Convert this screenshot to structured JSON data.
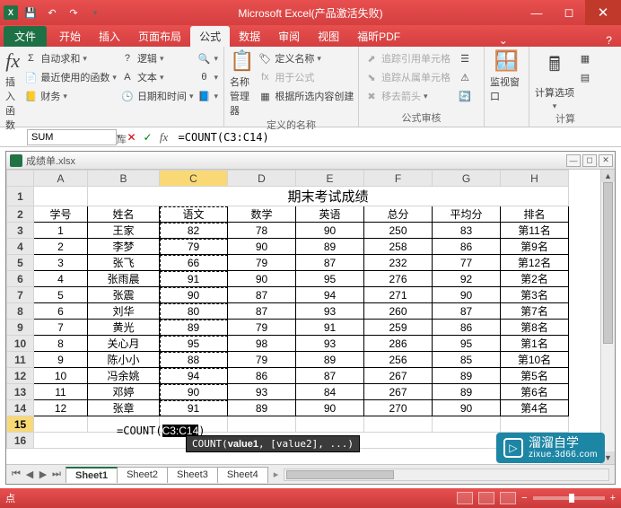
{
  "titlebar": {
    "app_title": "Microsoft Excel(产品激活失败)"
  },
  "tabs": {
    "file": "文件",
    "items": [
      "开始",
      "插入",
      "页面布局",
      "公式",
      "数据",
      "审阅",
      "视图",
      "福昕PDF"
    ],
    "active_index": 3
  },
  "ribbon": {
    "insert_fn": "插入函数",
    "autosum": "自动求和",
    "recent": "最近使用的函数",
    "financial": "财务",
    "logical": "逻辑",
    "text": "文本",
    "datetime": "日期和时间",
    "group_lib": "函数库",
    "name_mgr": "名称\n管理器",
    "def_name": "定义名称",
    "use_in_formula": "用于公式",
    "create_from_sel": "根据所选内容创建",
    "group_names": "定义的名称",
    "trace_prec": "追踪引用单元格",
    "trace_dep": "追踪从属单元格",
    "remove_arrows": "移去箭头",
    "group_audit": "公式审核",
    "watch": "监视窗口",
    "calc_opts": "计算选项",
    "group_calc": "计算"
  },
  "fbar": {
    "name": "SUM",
    "formula": "=COUNT(C3:C14)"
  },
  "workbook": {
    "filename": "成绩单.xlsx"
  },
  "grid": {
    "cols": [
      "A",
      "B",
      "C",
      "D",
      "E",
      "F",
      "G",
      "H"
    ],
    "title": "期末考试成绩",
    "headers": [
      "学号",
      "姓名",
      "语文",
      "数学",
      "英语",
      "总分",
      "平均分",
      "排名"
    ],
    "rows": [
      [
        "1",
        "王家",
        "82",
        "78",
        "90",
        "250",
        "83",
        "第11名"
      ],
      [
        "2",
        "李梦",
        "79",
        "90",
        "89",
        "258",
        "86",
        "第9名"
      ],
      [
        "3",
        "张飞",
        "66",
        "79",
        "87",
        "232",
        "77",
        "第12名"
      ],
      [
        "4",
        "张雨晨",
        "91",
        "90",
        "95",
        "276",
        "92",
        "第2名"
      ],
      [
        "5",
        "张震",
        "90",
        "87",
        "94",
        "271",
        "90",
        "第3名"
      ],
      [
        "6",
        "刘华",
        "80",
        "87",
        "93",
        "260",
        "87",
        "第7名"
      ],
      [
        "7",
        "黄光",
        "89",
        "79",
        "91",
        "259",
        "86",
        "第8名"
      ],
      [
        "8",
        "关心月",
        "95",
        "98",
        "93",
        "286",
        "95",
        "第1名"
      ],
      [
        "9",
        "陈小小",
        "88",
        "79",
        "89",
        "256",
        "85",
        "第10名"
      ],
      [
        "10",
        "冯余姚",
        "94",
        "86",
        "87",
        "267",
        "89",
        "第5名"
      ],
      [
        "11",
        "邓婷",
        "90",
        "93",
        "84",
        "267",
        "89",
        "第6名"
      ],
      [
        "12",
        "张章",
        "91",
        "89",
        "90",
        "270",
        "90",
        "第4名"
      ]
    ],
    "edit_cell": {
      "text_prefix": "=COUNT(",
      "text_sel": "C3:C14",
      "text_suffix": ")"
    },
    "tooltip": "COUNT(value1, [value2], ...)",
    "tooltip_bold": "value1"
  },
  "sheets": {
    "tabs": [
      "Sheet1",
      "Sheet2",
      "Sheet3",
      "Sheet4"
    ],
    "active": 0
  },
  "status": {
    "left": "点",
    "zoom_minus": "−",
    "zoom_plus": "+"
  },
  "brand": {
    "zh": "溜溜自学",
    "url": "zixue.3d66.com"
  }
}
